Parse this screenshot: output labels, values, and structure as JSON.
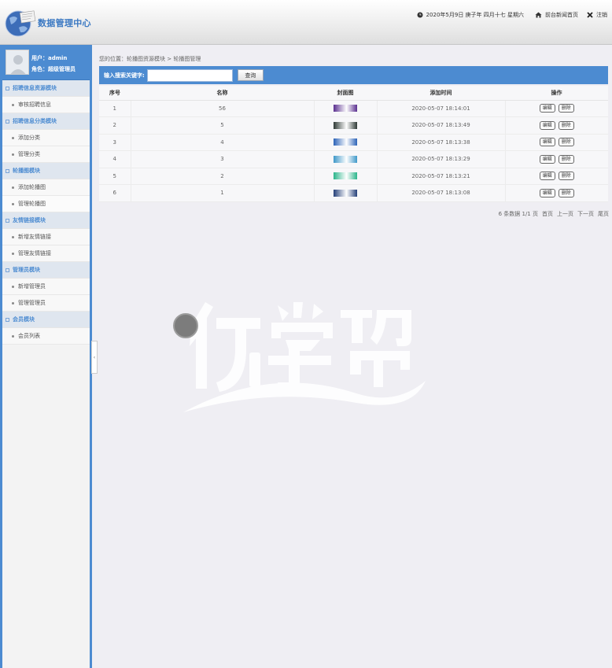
{
  "header": {
    "title": "数据管理中心",
    "datetime": "2020年5月9日 庚子年 四月十七 星期六",
    "home_link": "前台新闻首页",
    "logout_link": "注销"
  },
  "user": {
    "name_label": "用户：admin",
    "role_label": "角色：超级管理员"
  },
  "sidebar": {
    "groups": [
      {
        "title": "招聘信息资源模块",
        "items": [
          "审核招聘信息"
        ]
      },
      {
        "title": "招聘信息分类模块",
        "items": [
          "添加分类",
          "管理分类"
        ]
      },
      {
        "title": "轮播图模块",
        "items": [
          "添加轮播图",
          "管理轮播图"
        ]
      },
      {
        "title": "友情链接模块",
        "items": [
          "新增友情链接",
          "管理友情链接"
        ]
      },
      {
        "title": "管理员模块",
        "items": [
          "新增管理员",
          "管理管理员"
        ]
      },
      {
        "title": "会员模块",
        "items": [
          "会员列表"
        ]
      }
    ]
  },
  "main": {
    "breadcrumb": "您的位置：轮播图资源模块 > 轮播图管理",
    "search_label": "输入搜索关键字:",
    "search_value": "",
    "search_button": "查询",
    "columns": [
      "序号",
      "名称",
      "封面图",
      "添加时间",
      "操作"
    ],
    "rows": [
      {
        "no": "1",
        "name": "56",
        "time": "2020-05-07 18:14:01",
        "thumb_color": "#5a2f8f"
      },
      {
        "no": "2",
        "name": "5",
        "time": "2020-05-07 18:13:49",
        "thumb_color": "#2f3a36"
      },
      {
        "no": "3",
        "name": "4",
        "time": "2020-05-07 18:13:38",
        "thumb_color": "#2c63b8"
      },
      {
        "no": "4",
        "name": "3",
        "time": "2020-05-07 18:13:29",
        "thumb_color": "#3f98c9"
      },
      {
        "no": "5",
        "name": "2",
        "time": "2020-05-07 18:13:21",
        "thumb_color": "#2bb58b"
      },
      {
        "no": "6",
        "name": "1",
        "time": "2020-05-07 18:13:08",
        "thumb_color": "#25407a"
      }
    ],
    "edit_label": "编辑",
    "delete_label": "删除",
    "pager": {
      "summary": "6 条数据 1/1 页",
      "first": "首页",
      "prev": "上一页",
      "next": "下一页",
      "last": "尾页"
    }
  },
  "colors": {
    "accent": "#4c8bd1",
    "background": "#efeef3"
  },
  "icons": [
    "clock-icon",
    "home-icon",
    "close-icon",
    "globe-logo-icon",
    "avatar-icon"
  ]
}
